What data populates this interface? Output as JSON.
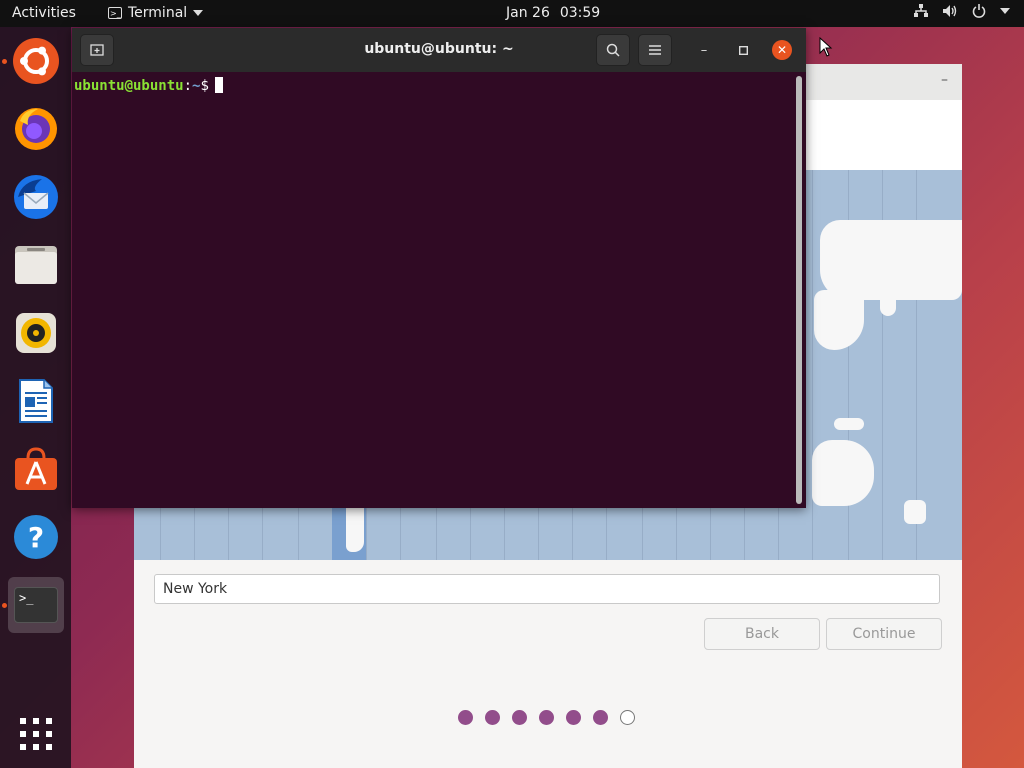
{
  "topbar": {
    "activities": "Activities",
    "app_name": "Terminal",
    "date": "Jan 26",
    "time": "03:59"
  },
  "dock": {
    "items": [
      {
        "name": "ubuntu-installer",
        "icon": "ubuntu-icon",
        "running": true
      },
      {
        "name": "firefox",
        "icon": "firefox-icon",
        "running": false
      },
      {
        "name": "thunderbird",
        "icon": "thunderbird-icon",
        "running": false
      },
      {
        "name": "files",
        "icon": "files-icon",
        "running": false
      },
      {
        "name": "rhythmbox",
        "icon": "rhythmbox-icon",
        "running": false
      },
      {
        "name": "libreoffice-writer",
        "icon": "writer-icon",
        "running": false
      },
      {
        "name": "ubuntu-software",
        "icon": "software-icon",
        "running": false
      },
      {
        "name": "help",
        "icon": "help-icon",
        "running": false
      },
      {
        "name": "terminal",
        "icon": "terminal-icon",
        "running": true
      },
      {
        "name": "show-applications",
        "icon": "grid-icon",
        "running": false
      }
    ],
    "terminal_glyph": ">_",
    "help_glyph": "?"
  },
  "terminal": {
    "title": "ubuntu@ubuntu: ~",
    "prompt_user": "ubuntu@ubuntu",
    "prompt_sep": ":",
    "prompt_path": "~",
    "prompt_symbol": "$"
  },
  "installer": {
    "timezone_value": "New York",
    "back_label": "Back",
    "continue_label": "Continue",
    "steps_total": 7,
    "steps_completed": 6
  },
  "colors": {
    "accent": "#e95420",
    "terminal_bg": "#300a24",
    "step_dot": "#924d8b"
  }
}
